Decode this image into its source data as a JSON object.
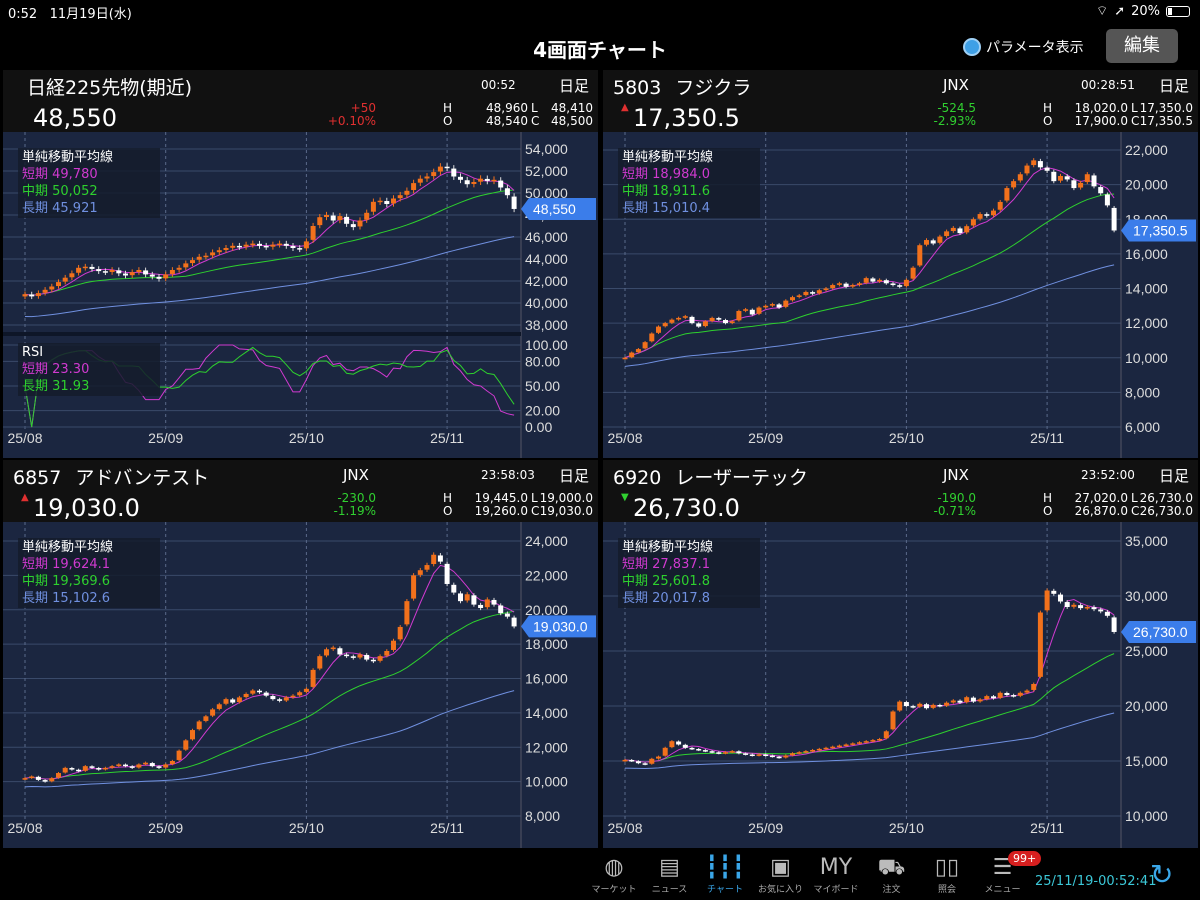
{
  "status": {
    "time": "0:52",
    "date": "11月19日(水)",
    "battery": "20%",
    "battery_fraction": 0.2
  },
  "header": {
    "title": "4画面チャート",
    "param_label": "パラメータ表示",
    "edit_label": "編集"
  },
  "colors": {
    "up": "#f2711c",
    "down": "#ffffff",
    "short": "#d03ad0",
    "mid": "#2ed02e",
    "long": "#7090e0",
    "tag": "#3b7dea",
    "plus": "#e03030",
    "minus": "#30d030"
  },
  "panels": [
    {
      "code": "",
      "name": "日経225先物(期近)",
      "exchange": "",
      "time": "00:52",
      "freq": "日足",
      "arrow": "",
      "price": "48,550",
      "change": "+50",
      "change_pct": "+0.10%",
      "dir": "plus",
      "H": "48,960",
      "L": "48,410",
      "O": "48,540",
      "C": "48,500",
      "tag": "48,550",
      "legend": {
        "title": "単純移動平均線",
        "short": "短期 49,780",
        "mid": "中期 50,052",
        "long": "長期 45,921"
      },
      "rsi": {
        "title": "RSI",
        "short": "短期 23.30",
        "long": "長期 31.93"
      }
    },
    {
      "code": "5803",
      "name": "フジクラ",
      "exchange": "JNX",
      "time": "00:28:51",
      "freq": "日足",
      "arrow": "▲",
      "price": "17,350.5",
      "change": "-524.5",
      "change_pct": "-2.93%",
      "dir": "minus",
      "H": "18,020.0",
      "L": "17,350.0",
      "O": "17,900.0",
      "C": "17,350.5",
      "tag": "17,350.5",
      "legend": {
        "title": "単純移動平均線",
        "short": "短期 18,984.0",
        "mid": "中期 18,911.6",
        "long": "長期 15,010.4"
      }
    },
    {
      "code": "6857",
      "name": "アドバンテスト",
      "exchange": "JNX",
      "time": "23:58:03",
      "freq": "日足",
      "arrow": "▲",
      "price": "19,030.0",
      "change": "-230.0",
      "change_pct": "-1.19%",
      "dir": "minus",
      "H": "19,445.0",
      "L": "19,000.0",
      "O": "19,260.0",
      "C": "19,030.0",
      "tag": "19,030.0",
      "legend": {
        "title": "単純移動平均線",
        "short": "短期 19,624.1",
        "mid": "中期 19,369.6",
        "long": "長期 15,102.6"
      }
    },
    {
      "code": "6920",
      "name": "レーザーテック",
      "exchange": "JNX",
      "time": "23:52:00",
      "freq": "日足",
      "arrow": "▼",
      "price": "26,730.0",
      "change": "-190.0",
      "change_pct": "-0.71%",
      "dir": "minus",
      "H": "27,020.0",
      "L": "26,730.0",
      "O": "26,870.0",
      "C": "26,730.0",
      "tag": "26,730.0",
      "legend": {
        "title": "単純移動平均線",
        "short": "短期 27,837.1",
        "mid": "中期 25,601.8",
        "long": "長期 20,017.8"
      }
    }
  ],
  "chart_data": [
    {
      "type": "candlestick",
      "title": "日経225先物(期近)",
      "x_labels": [
        "25/08",
        "25/09",
        "25/10",
        "25/11"
      ],
      "ylim": [
        37500,
        54500
      ],
      "yticks": [
        38000,
        40000,
        42000,
        44000,
        46000,
        48000,
        50000,
        52000,
        54000
      ],
      "rsi_ticks": [
        0,
        20,
        50,
        80,
        100
      ],
      "close": [
        40800,
        40600,
        40900,
        41200,
        41500,
        41900,
        42300,
        42700,
        43200,
        43300,
        43100,
        42900,
        42800,
        43000,
        42700,
        42500,
        42800,
        43000,
        42600,
        42400,
        42200,
        42600,
        43000,
        43200,
        43600,
        43900,
        44200,
        44300,
        44600,
        44800,
        45000,
        45200,
        45100,
        45300,
        45400,
        45200,
        45100,
        45300,
        45400,
        45200,
        45000,
        44900,
        45600,
        47000,
        47800,
        48000,
        47500,
        47900,
        47200,
        46900,
        47500,
        48200,
        49200,
        49300,
        49000,
        49500,
        49800,
        50200,
        50900,
        51300,
        51500,
        51900,
        52400,
        52300,
        51500,
        51200,
        50800,
        51000,
        51300,
        51100,
        51200,
        50500,
        49800,
        48550
      ]
    },
    {
      "type": "candlestick",
      "title": "フジクラ",
      "x_labels": [
        "25/08",
        "25/09",
        "25/10",
        "25/11"
      ],
      "ylim": [
        6000,
        22000
      ],
      "yticks": [
        6000,
        8000,
        10000,
        12000,
        14000,
        16000,
        18000,
        20000,
        22000
      ],
      "close": [
        10000,
        10300,
        10500,
        10900,
        11400,
        11800,
        12000,
        12200,
        12300,
        12400,
        12000,
        11800,
        12100,
        12300,
        12200,
        12000,
        12100,
        12700,
        12800,
        12500,
        12900,
        13000,
        13100,
        12900,
        13300,
        13500,
        13600,
        13800,
        13700,
        13900,
        14000,
        14200,
        14300,
        14100,
        14200,
        14300,
        14600,
        14400,
        14500,
        14300,
        14200,
        14100,
        14500,
        15200,
        16500,
        16800,
        16600,
        17000,
        17300,
        17500,
        17200,
        17600,
        18000,
        18300,
        18200,
        18500,
        19000,
        19800,
        20200,
        20600,
        21100,
        21400,
        21000,
        20800,
        20200,
        20500,
        20300,
        19800,
        20100,
        20600,
        19900,
        19500,
        18800,
        17350.5
      ]
    },
    {
      "type": "candlestick",
      "title": "アドバンテスト",
      "x_labels": [
        "25/08",
        "25/09",
        "25/10",
        "25/11"
      ],
      "ylim": [
        8000,
        24000
      ],
      "yticks": [
        8000,
        10000,
        12000,
        14000,
        16000,
        18000,
        20000,
        22000,
        24000
      ],
      "close": [
        10200,
        10300,
        10100,
        10000,
        10200,
        10500,
        10800,
        10700,
        10600,
        10900,
        10800,
        10700,
        10800,
        10900,
        11000,
        10900,
        10800,
        11000,
        11100,
        10900,
        10800,
        11000,
        11200,
        11800,
        12400,
        13000,
        13500,
        13800,
        14200,
        14500,
        14800,
        14600,
        14900,
        15100,
        15300,
        15200,
        15000,
        14800,
        14700,
        14900,
        15000,
        15200,
        15400,
        16500,
        17300,
        17700,
        17800,
        17400,
        17300,
        17200,
        17400,
        17100,
        17000,
        17300,
        17600,
        18200,
        19000,
        20500,
        22000,
        22300,
        22600,
        23200,
        22800,
        21500,
        21000,
        20500,
        20900,
        20300,
        20100,
        20600,
        20300,
        19800,
        19600,
        19030
      ]
    },
    {
      "type": "candlestick",
      "title": "レーザーテック",
      "x_labels": [
        "25/08",
        "25/09",
        "25/10",
        "25/11"
      ],
      "ylim": [
        10000,
        35000
      ],
      "yticks": [
        10000,
        15000,
        20000,
        25000,
        30000,
        35000
      ],
      "close": [
        15100,
        15000,
        14800,
        14700,
        15200,
        15400,
        16200,
        16800,
        16500,
        16200,
        16100,
        16000,
        15900,
        15800,
        15700,
        15800,
        15900,
        15700,
        15600,
        15500,
        15600,
        15500,
        15400,
        15300,
        15500,
        15700,
        15800,
        15900,
        16000,
        16100,
        16200,
        16300,
        16400,
        16500,
        16600,
        16700,
        16800,
        16900,
        17000,
        17700,
        19500,
        20400,
        20000,
        19900,
        20200,
        19800,
        20100,
        20000,
        20300,
        20500,
        20300,
        20800,
        20400,
        20600,
        20900,
        20700,
        21200,
        21000,
        20900,
        21200,
        21400,
        22000,
        28500,
        30500,
        30200,
        29500,
        29000,
        29200,
        28900,
        29000,
        28800,
        28600,
        28200,
        26730
      ]
    }
  ],
  "toolbar": {
    "items": [
      {
        "label": "マーケット",
        "icon": "globe-icon",
        "glyph": "◍"
      },
      {
        "label": "ニュース",
        "icon": "newspaper-icon",
        "glyph": "▤"
      },
      {
        "label": "チャート",
        "icon": "candlestick-icon",
        "glyph": "┇┇┇"
      },
      {
        "label": "お気に入り",
        "icon": "folder-search-icon",
        "glyph": "▣"
      },
      {
        "label": "マイボード",
        "icon": "myboard-icon",
        "glyph": "MY"
      },
      {
        "label": "注文",
        "icon": "cart-icon",
        "glyph": "⛟"
      },
      {
        "label": "照会",
        "icon": "book-icon",
        "glyph": "▯▯"
      },
      {
        "label": "メニュー",
        "icon": "menu-list-icon",
        "glyph": "☰"
      }
    ],
    "badge": "99+",
    "timestamp": "25/11/19-00:52:41"
  }
}
